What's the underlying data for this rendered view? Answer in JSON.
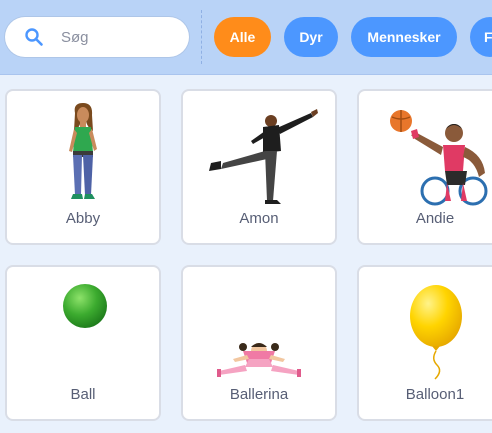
{
  "search": {
    "placeholder": "Søg",
    "icon": "search-icon"
  },
  "tags": [
    {
      "label": "Alle",
      "active": true
    },
    {
      "label": "Dyr",
      "active": false
    },
    {
      "label": "Mennesker",
      "active": false
    },
    {
      "label": "F",
      "active": false
    }
  ],
  "sprites": [
    {
      "name": "Abby"
    },
    {
      "name": "Amon"
    },
    {
      "name": "Andie"
    },
    {
      "name": "Ball"
    },
    {
      "name": "Ballerina"
    },
    {
      "name": "Balloon1"
    }
  ],
  "colors": {
    "topbar": "#b9d3f7",
    "background": "#e9f1fc",
    "tag": "#4c97ff",
    "tag_active": "#ff8c1a",
    "label_text": "#575e75"
  }
}
